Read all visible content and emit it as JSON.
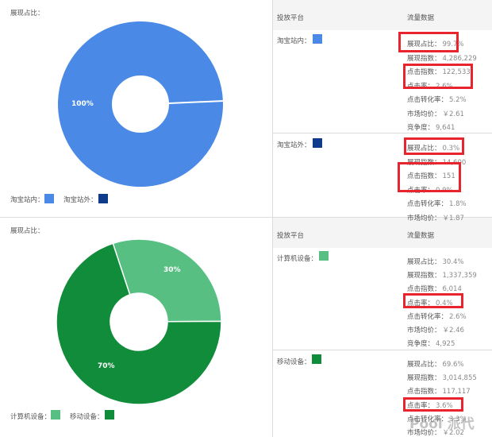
{
  "colors": {
    "taobao_in": "#4a8ae6",
    "taobao_out": "#0e3b8a",
    "computer": "#57bf82",
    "mobile": "#108c3a",
    "highlight": "#e8252e",
    "header_band": "#f4f4f4"
  },
  "top": {
    "chart_title": "展现占比：",
    "header_platform": "投放平台",
    "header_data": "流量数据",
    "legend": [
      {
        "label": "淘宝站内：",
        "color": "#4a8ae6"
      },
      {
        "label": "淘宝站外：",
        "color": "#0e3b8a"
      }
    ],
    "platforms": [
      {
        "name": "淘宝站内：",
        "color": "#4a8ae6",
        "rows": [
          {
            "label": "展现占比：",
            "value": "99.7%"
          },
          {
            "label": "展现指数：",
            "value": "4,286,229"
          },
          {
            "label": "点击指数：",
            "value": "122,533"
          },
          {
            "label": "点击率：",
            "value": "2.6%"
          },
          {
            "label": "点击转化率：",
            "value": "5.2%"
          },
          {
            "label": "市场均价：",
            "value": "￥2.61"
          },
          {
            "label": "竞争度：",
            "value": "9,641"
          }
        ]
      },
      {
        "name": "淘宝站外：",
        "color": "#0e3b8a",
        "rows": [
          {
            "label": "展现占比：",
            "value": "0.3%"
          },
          {
            "label": "展现指数：",
            "value": "14,600"
          },
          {
            "label": "点击指数：",
            "value": "151"
          },
          {
            "label": "点击率：",
            "value": "0.9%"
          },
          {
            "label": "点击转化率：",
            "value": "1.8%"
          },
          {
            "label": "市场均价：",
            "value": "￥1.87"
          }
        ]
      }
    ]
  },
  "bottom": {
    "chart_title": "展现占比：",
    "header_platform": "投放平台",
    "header_data": "流量数据",
    "legend": [
      {
        "label": "计算机设备：",
        "color": "#57bf82"
      },
      {
        "label": "移动设备：",
        "color": "#108c3a"
      }
    ],
    "platforms": [
      {
        "name": "计算机设备：",
        "color": "#57bf82",
        "rows": [
          {
            "label": "展现占比：",
            "value": "30.4%"
          },
          {
            "label": "展现指数：",
            "value": "1,337,359"
          },
          {
            "label": "点击指数：",
            "value": "6,014"
          },
          {
            "label": "点击率：",
            "value": "0.4%"
          },
          {
            "label": "点击转化率：",
            "value": "2.6%"
          },
          {
            "label": "市场均价：",
            "value": "￥2.46"
          },
          {
            "label": "竞争度：",
            "value": "4,925"
          }
        ]
      },
      {
        "name": "移动设备：",
        "color": "#108c3a",
        "rows": [
          {
            "label": "展现占比：",
            "value": "69.6%"
          },
          {
            "label": "展现指数：",
            "value": "3,014,855"
          },
          {
            "label": "点击指数：",
            "value": "117,117"
          },
          {
            "label": "点击率：",
            "value": "3.6%"
          },
          {
            "label": "点击转化率：",
            "value": "3.3%"
          },
          {
            "label": "市场均价：",
            "value": "￥2.02"
          }
        ]
      }
    ]
  },
  "watermark": "Pool 派代",
  "chart_data": [
    {
      "type": "pie",
      "title": "展现占比：",
      "categories": [
        "淘宝站内",
        "淘宝站外"
      ],
      "values": [
        100,
        0
      ],
      "labels": [
        "100%",
        "0%"
      ],
      "colors": [
        "#4a8ae6",
        "#0e3b8a"
      ],
      "legend_position": "bottom-left",
      "donut": true
    },
    {
      "type": "pie",
      "title": "展现占比：",
      "categories": [
        "计算机设备",
        "移动设备"
      ],
      "values": [
        30,
        70
      ],
      "labels": [
        "30%",
        "70%"
      ],
      "colors": [
        "#57bf82",
        "#108c3a"
      ],
      "legend_position": "bottom-left",
      "donut": true
    }
  ]
}
